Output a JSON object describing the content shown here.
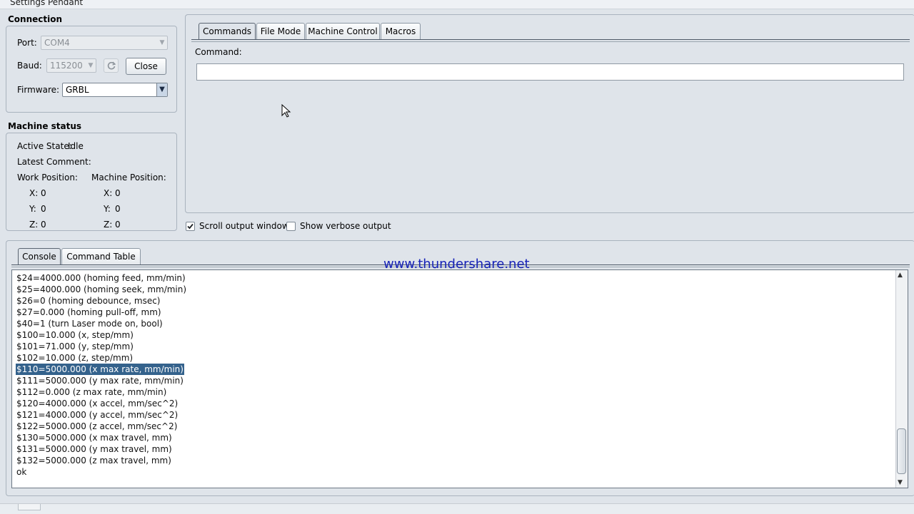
{
  "menu": [
    "Settings",
    "Pendant"
  ],
  "connection": {
    "title": "Connection",
    "port_label": "Port:",
    "port_value": "COM4",
    "baud_label": "Baud:",
    "baud_value": "115200",
    "close_label": "Close",
    "firmware_label": "Firmware:",
    "firmware_value": "GRBL"
  },
  "machine_status": {
    "title": "Machine status",
    "active_state_label": "Active State:",
    "active_state_value": "Idle",
    "latest_comment_label": "Latest Comment:",
    "work_position_label": "Work Position:",
    "machine_position_label": "Machine Position:",
    "work": {
      "x_label": "X:",
      "x": "0",
      "y_label": "Y:",
      "y": "0",
      "z_label": "Z:",
      "z": "0"
    },
    "machine": {
      "x_label": "X:",
      "x": "0",
      "y_label": "Y:",
      "y": "0",
      "z_label": "Z:",
      "z": "0"
    }
  },
  "tabs": [
    "Commands",
    "File Mode",
    "Machine Control",
    "Macros"
  ],
  "command": {
    "label": "Command:",
    "value": ""
  },
  "options": {
    "scroll_output": {
      "label": "Scroll output window",
      "checked": true
    },
    "verbose_output": {
      "label": "Show verbose output",
      "checked": false
    }
  },
  "console_tabs": [
    "Console",
    "Command Table"
  ],
  "watermark": "www.thundershare.net",
  "console_lines": [
    "$24=4000.000 (homing feed, mm/min)",
    "$25=4000.000 (homing seek, mm/min)",
    "$26=0 (homing debounce, msec)",
    "$27=0.000 (homing pull-off, mm)",
    "$40=1 (turn Laser mode on, bool)",
    "$100=10.000 (x, step/mm)",
    "$101=71.000 (y, step/mm)",
    "$102=10.000 (z, step/mm)",
    "$110=5000.000 (x max rate, mm/min)",
    "$111=5000.000 (y max rate, mm/min)",
    "$112=0.000 (z max rate, mm/min)",
    "$120=4000.000 (x accel, mm/sec^2)",
    "$121=4000.000 (y accel, mm/sec^2)",
    "$122=5000.000 (z accel, mm/sec^2)",
    "$130=5000.000 (x max travel, mm)",
    "$131=5000.000 (y max travel, mm)",
    "$132=5000.000 (z max travel, mm)",
    "ok"
  ],
  "selected_line": "$110=5000.000 (x max rate, mm/min)"
}
